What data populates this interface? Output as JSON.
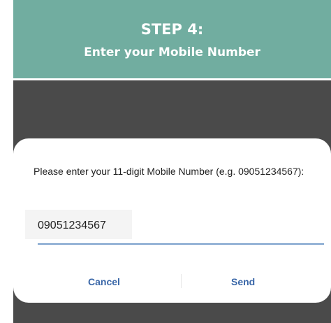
{
  "banner": {
    "title": "STEP 4:",
    "subtitle": "Enter your Mobile Number"
  },
  "dialog": {
    "prompt": "Please enter your 11-digit Mobile Number (e.g. 09051234567):",
    "input_value": "09051234567",
    "cancel_label": "Cancel",
    "send_label": "Send"
  },
  "colors": {
    "banner_bg": "#71ada0",
    "backdrop": "#4a4a4a",
    "accent": "#3a67a8"
  }
}
